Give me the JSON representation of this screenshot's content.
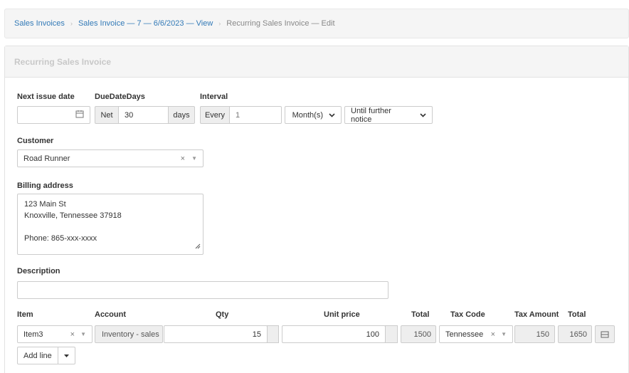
{
  "breadcrumb": {
    "items": [
      "Sales Invoices",
      "Sales Invoice — 7 — 6/6/2023 — View"
    ],
    "current": "Recurring Sales Invoice — Edit"
  },
  "panel": {
    "title": "Recurring Sales Invoice"
  },
  "form": {
    "next_issue_date": {
      "label": "Next issue date",
      "value": ""
    },
    "due_date_days": {
      "label": "DueDateDays",
      "prefix": "Net",
      "value": "30",
      "suffix": "days"
    },
    "interval": {
      "label": "Interval",
      "prefix": "Every",
      "value": "1",
      "unit": "Month(s)",
      "end": "Until further notice"
    },
    "customer": {
      "label": "Customer",
      "value": "Road Runner"
    },
    "billing_address": {
      "label": "Billing address",
      "lines": [
        "123 Main St",
        "Knoxville, Tennessee 37918",
        "",
        "Phone: 865-xxx-xxxx"
      ]
    },
    "description": {
      "label": "Description",
      "value": ""
    }
  },
  "lines": {
    "headers": [
      "Item",
      "Account",
      "Qty",
      "Unit price",
      "Total",
      "Tax Code",
      "Tax Amount",
      "Total"
    ],
    "rows": [
      {
        "item": "Item3",
        "account": "Inventory - sales",
        "qty": "15",
        "unit_price": "100",
        "total": "1500",
        "tax_code": "Tennessee",
        "tax_amount": "150",
        "grand_total": "1650"
      }
    ],
    "add_line_label": "Add line"
  },
  "icons": {
    "calendar": "calendar-icon",
    "clear": "clear-x-icon",
    "caret": "caret-down-icon",
    "detail": "detail-icon",
    "resize": "resize-handle-icon"
  },
  "colors": {
    "link": "#337ab7",
    "panel_heading_bg": "#f5f5f5",
    "addon_bg": "#eeeeee"
  }
}
